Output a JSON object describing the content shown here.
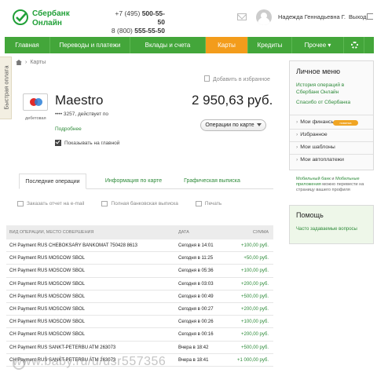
{
  "header": {
    "logo_line1": "Сбербанк",
    "logo_line2": "Онлайн",
    "phone1_prefix": "+7 (495)",
    "phone1_number": "500-55-50",
    "phone2_prefix": "8 (800)",
    "phone2_number": "555-55-50",
    "user_name": "Надежда Геннадьевна Г.",
    "logout_label": "Выход"
  },
  "nav": {
    "items": [
      {
        "label": "Главная"
      },
      {
        "label": "Переводы и платежи"
      },
      {
        "label": "Вклады и счета"
      },
      {
        "label": "Карты"
      },
      {
        "label": "Кредиты"
      },
      {
        "label": "Прочее ▾"
      }
    ],
    "active": "Карты"
  },
  "quick_pay_label": "Быстрая оплата",
  "breadcrumb": {
    "current": "Карты"
  },
  "favorite_label": "Добавить в избранное",
  "card": {
    "logo_text": "Maestro",
    "type_label": "дебетовая",
    "name": "Maestro",
    "number_text": "•••• 3257, действует по",
    "balance": "2 950,63 руб.",
    "details_label": "Подробнее",
    "operations_button": "Операции по карте",
    "show_on_main_label": "Показывать на главной"
  },
  "tabs": [
    {
      "label": "Последние операции"
    },
    {
      "label": "Информация по карте"
    },
    {
      "label": "Графическая выписка"
    }
  ],
  "actions": [
    {
      "label": "Заказать отчет на e-mail",
      "icon": "mail-icon"
    },
    {
      "label": "Полная банковская выписка",
      "icon": "document-icon"
    },
    {
      "label": "Печать",
      "icon": "printer-icon"
    }
  ],
  "table": {
    "headers": {
      "description": "Вид операции, место совершения",
      "date": "Дата",
      "sum": "Сумма"
    },
    "rows": [
      {
        "desc": "CH Payment RUS CHEBOKSARY BANKOMAT 750428 8613",
        "date": "Сегодня в 14:01",
        "sum": "+100,00 руб."
      },
      {
        "desc": "CH Payment RUS MOSCOW SBOL",
        "date": "Сегодня в 11:25",
        "sum": "+50,00 руб."
      },
      {
        "desc": "CH Payment RUS MOSCOW SBOL",
        "date": "Сегодня в 05:36",
        "sum": "+100,00 руб."
      },
      {
        "desc": "CH Payment RUS MOSCOW SBOL",
        "date": "Сегодня в 03:03",
        "sum": "+200,00 руб."
      },
      {
        "desc": "CH Payment RUS MOSCOW SBOL",
        "date": "Сегодня в 00:49",
        "sum": "+500,00 руб."
      },
      {
        "desc": "CH Payment RUS MOSCOW SBOL",
        "date": "Сегодня в 00:27",
        "sum": "+200,00 руб."
      },
      {
        "desc": "CH Payment RUS MOSCOW SBOL",
        "date": "Сегодня в 00:26",
        "sum": "+100,00 руб."
      },
      {
        "desc": "CH Payment RUS MOSCOW SBOL",
        "date": "Сегодня в 00:16",
        "sum": "+200,00 руб."
      },
      {
        "desc": "CH Payment RUS SANKT-PETERBU ATM 263073",
        "date": "Вчера в 18:42",
        "sum": "+500,00 руб."
      },
      {
        "desc": "CH Payment RUS SANKT-PETERBU ATM 263073",
        "date": "Вчера в 18:41",
        "sum": "+1 000,00 руб."
      }
    ]
  },
  "sidebar": {
    "title": "Личное меню",
    "link1": "История операций в Сбербанк Онлайн",
    "link2": "Спасибо от Сбербанка",
    "items": [
      {
        "label": "Мои финансы"
      },
      {
        "label": "Избранное"
      },
      {
        "label": "Мои шаблоны"
      },
      {
        "label": "Мои автоплатежи"
      }
    ],
    "badge": "новинка",
    "promo_link1": "Мобильный банк",
    "promo_and": " и ",
    "promo_link2": "Мобильные приложения",
    "promo_rest": " можно перевести на страницу вашего профиля"
  },
  "help": {
    "title": "Помощь",
    "link": "Часто задаваемые вопросы"
  },
  "watermark": "www.baby.ru/u/usr557356",
  "colors": {
    "brand_green": "#43a63a",
    "active_orange": "#f39c1b",
    "link_green": "#2e8b3a"
  }
}
